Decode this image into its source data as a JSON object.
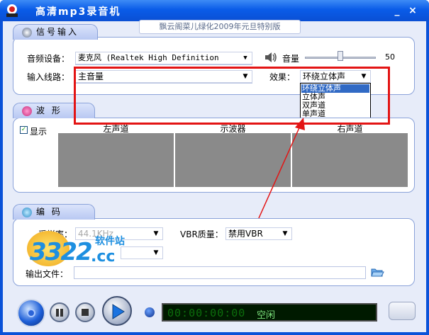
{
  "app": {
    "title": "高清mp3录音机",
    "subtitle": "飘云阁菜儿绿化2009年元旦特别版"
  },
  "input_panel": {
    "tab_label": "信号输入",
    "device_label": "音频设备：",
    "device_value": "麦克风 (Realtek High Definition",
    "volume_label": "音量",
    "volume_value": "50",
    "volume_level": 0.5,
    "line_label": "输入线路：",
    "line_value": "主音量",
    "effect_label": "效果：",
    "effect_value": "环绕立体声",
    "effect_options": [
      "环绕立体声",
      "立体声",
      "双声道",
      "单声道"
    ]
  },
  "wave_panel": {
    "tab_label": "波    形",
    "show_label": "显示",
    "headers": [
      "左声道",
      "示波器",
      "右声道"
    ]
  },
  "encode_panel": {
    "tab_label": "编    码",
    "sample_label": "采样率：",
    "sample_value": "44.1KHz",
    "vbr_label": "VBR质量：",
    "vbr_value": "禁用VBR",
    "output_label": "输出文件："
  },
  "watermark": {
    "number": "3322",
    "site_cn": "软件站",
    "suffix": ".cc"
  },
  "status": {
    "digits": "00:00:00:00",
    "text": "空闲"
  },
  "colors": {
    "accent": "#0a52d8",
    "highlight": "#e31414",
    "lcd_text": "#7ce27c"
  }
}
